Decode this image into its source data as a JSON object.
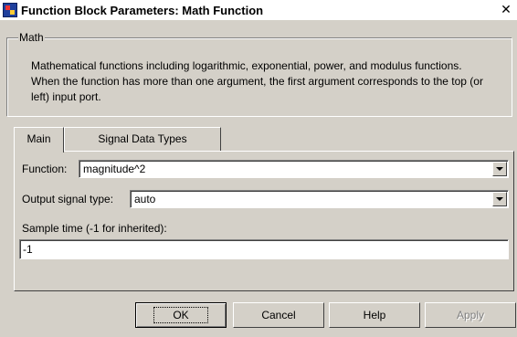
{
  "window": {
    "title": "Function Block Parameters: Math Function",
    "close_glyph": "✕"
  },
  "group": {
    "legend": "Math",
    "description": "Mathematical functions including logarithmic, exponential, power, and modulus functions.  When the function has more than one argument, the first argument corresponds to the top (or left) input port."
  },
  "tabs": [
    {
      "label": "Main",
      "active": true
    },
    {
      "label": "Signal Data Types",
      "active": false
    }
  ],
  "main": {
    "function_label": "Function:",
    "function_value": "magnitude^2",
    "output_type_label": "Output signal type:",
    "output_type_value": "auto",
    "sample_time_label": "Sample time (-1 for inherited):",
    "sample_time_value": "-1"
  },
  "buttons": {
    "ok": "OK",
    "cancel": "Cancel",
    "help": "Help",
    "apply": "Apply"
  }
}
